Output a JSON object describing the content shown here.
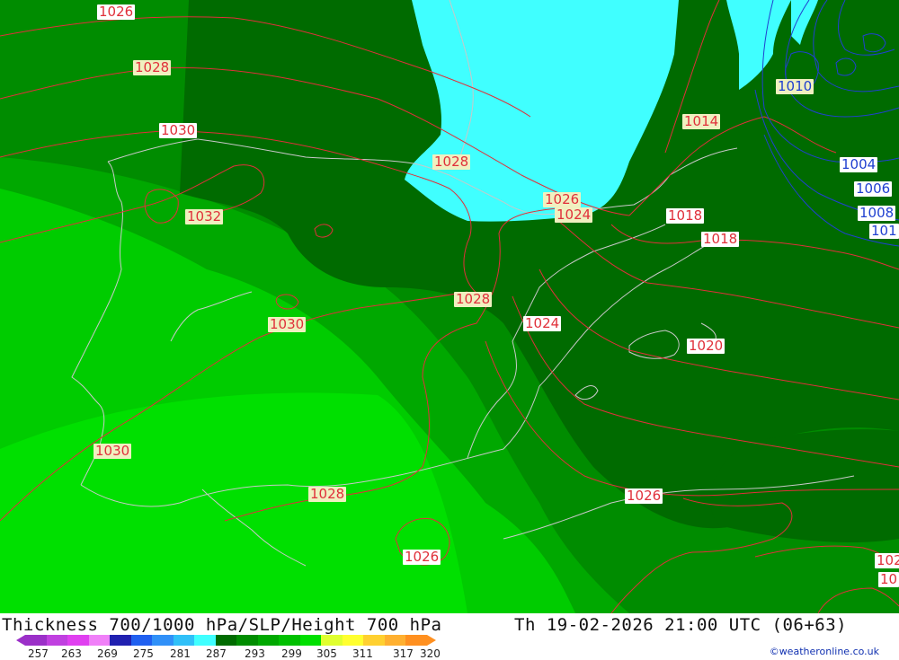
{
  "map": {
    "title": "Thickness 700/1000 hPa/SLP/Height 700 hPa",
    "datetime": "Th 19-02-2026 21:00 UTC (06+63)",
    "credit": "©weatheronline.co.uk",
    "colors": {
      "cold": "#40ffff",
      "dark_green": "#006b00",
      "mid_green": "#008c00",
      "green": "#00a800",
      "bright_green": "#00cc00",
      "vivid_green": "#00e000",
      "isobar_red": "#e0303a",
      "isobar_blue": "#2040d0",
      "coast": "#c8c8c8"
    },
    "pressure_labels": [
      {
        "text": "1026",
        "color": "red"
      },
      {
        "text": "1028",
        "color": "red"
      },
      {
        "text": "1030",
        "color": "red"
      },
      {
        "text": "1028",
        "color": "red"
      },
      {
        "text": "1026",
        "color": "red"
      },
      {
        "text": "1024",
        "color": "red"
      },
      {
        "text": "1014",
        "color": "red"
      },
      {
        "text": "1010",
        "color": "blue"
      },
      {
        "text": "1004",
        "color": "blue"
      },
      {
        "text": "1006",
        "color": "blue"
      },
      {
        "text": "1008",
        "color": "blue"
      },
      {
        "text": "101",
        "color": "blue"
      },
      {
        "text": "1018",
        "color": "red"
      },
      {
        "text": "1018",
        "color": "red"
      },
      {
        "text": "1032",
        "color": "red"
      },
      {
        "text": "1028",
        "color": "red"
      },
      {
        "text": "1030",
        "color": "red"
      },
      {
        "text": "1024",
        "color": "red"
      },
      {
        "text": "1020",
        "color": "red"
      },
      {
        "text": "1030",
        "color": "red"
      },
      {
        "text": "1028",
        "color": "red"
      },
      {
        "text": "1026",
        "color": "red"
      },
      {
        "text": "1026",
        "color": "red"
      },
      {
        "text": "102",
        "color": "red"
      },
      {
        "text": "10",
        "color": "red"
      }
    ],
    "legend": {
      "ticks": [
        "257",
        "263",
        "269",
        "275",
        "281",
        "287",
        "293",
        "299",
        "305",
        "311",
        "317",
        "320"
      ],
      "colors": [
        "#9b30c8",
        "#c040e0",
        "#e040f0",
        "#f080f8",
        "#2020b0",
        "#2060f0",
        "#3090f8",
        "#30c0f8",
        "#40ffff",
        "#006b00",
        "#008c00",
        "#00a800",
        "#00c000",
        "#00e000",
        "#e0ff30",
        "#ffff30",
        "#ffd030",
        "#ffb030",
        "#ff9020"
      ]
    }
  }
}
